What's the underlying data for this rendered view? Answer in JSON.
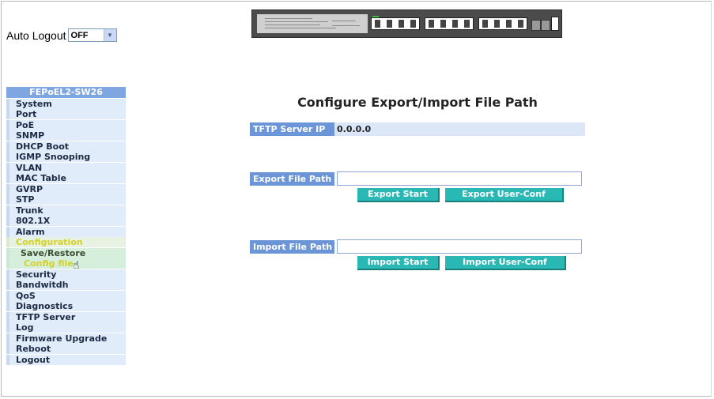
{
  "auto_logout": {
    "label": "Auto Logout",
    "selected": "OFF"
  },
  "menu": {
    "header": "FEPoEL2-SW26",
    "items": [
      {
        "label": "System",
        "state": "normal"
      },
      {
        "label": "Port",
        "state": "normal"
      },
      {
        "label": "PoE",
        "state": "normal"
      },
      {
        "label": "SNMP",
        "state": "normal"
      },
      {
        "label": "DHCP Boot",
        "state": "normal"
      },
      {
        "label": "IGMP Snooping",
        "state": "normal"
      },
      {
        "label": "VLAN",
        "state": "normal"
      },
      {
        "label": "MAC Table",
        "state": "normal"
      },
      {
        "label": "GVRP",
        "state": "normal"
      },
      {
        "label": "STP",
        "state": "normal"
      },
      {
        "label": "Trunk",
        "state": "normal"
      },
      {
        "label": "802.1X",
        "state": "normal"
      },
      {
        "label": "Alarm",
        "state": "normal"
      },
      {
        "label": "Configuration",
        "state": "active"
      },
      {
        "label": "Save/Restore",
        "state": "sub"
      },
      {
        "label": "Config file",
        "state": "subsel"
      },
      {
        "label": "Security",
        "state": "normal"
      },
      {
        "label": "Bandwitdh",
        "state": "normal"
      },
      {
        "label": "QoS",
        "state": "normal"
      },
      {
        "label": "Diagnostics",
        "state": "normal"
      },
      {
        "label": "TFTP Server",
        "state": "normal"
      },
      {
        "label": "Log",
        "state": "normal"
      },
      {
        "label": "Firmware Upgrade",
        "state": "normal"
      },
      {
        "label": "Reboot",
        "state": "normal"
      },
      {
        "label": "Logout",
        "state": "normal"
      }
    ]
  },
  "main": {
    "title": "Configure Export/Import File Path",
    "tftp": {
      "label": "TFTP Server IP",
      "value": "0.0.0.0"
    },
    "export": {
      "label": "Export File Path",
      "value": "",
      "start_button": "Export Start",
      "userconf_button": "Export User-Conf"
    },
    "import": {
      "label": "Import File Path",
      "value": "",
      "start_button": "Import Start",
      "userconf_button": "Import User-Conf"
    }
  },
  "colors": {
    "label_bg": "#6c95d8",
    "button_bg": "#2ab8b5",
    "menu_header_bg": "#7fa6e0"
  },
  "icons": {
    "select_arrow": "chevron-down-icon",
    "cursor": "hand-pointer-icon"
  }
}
